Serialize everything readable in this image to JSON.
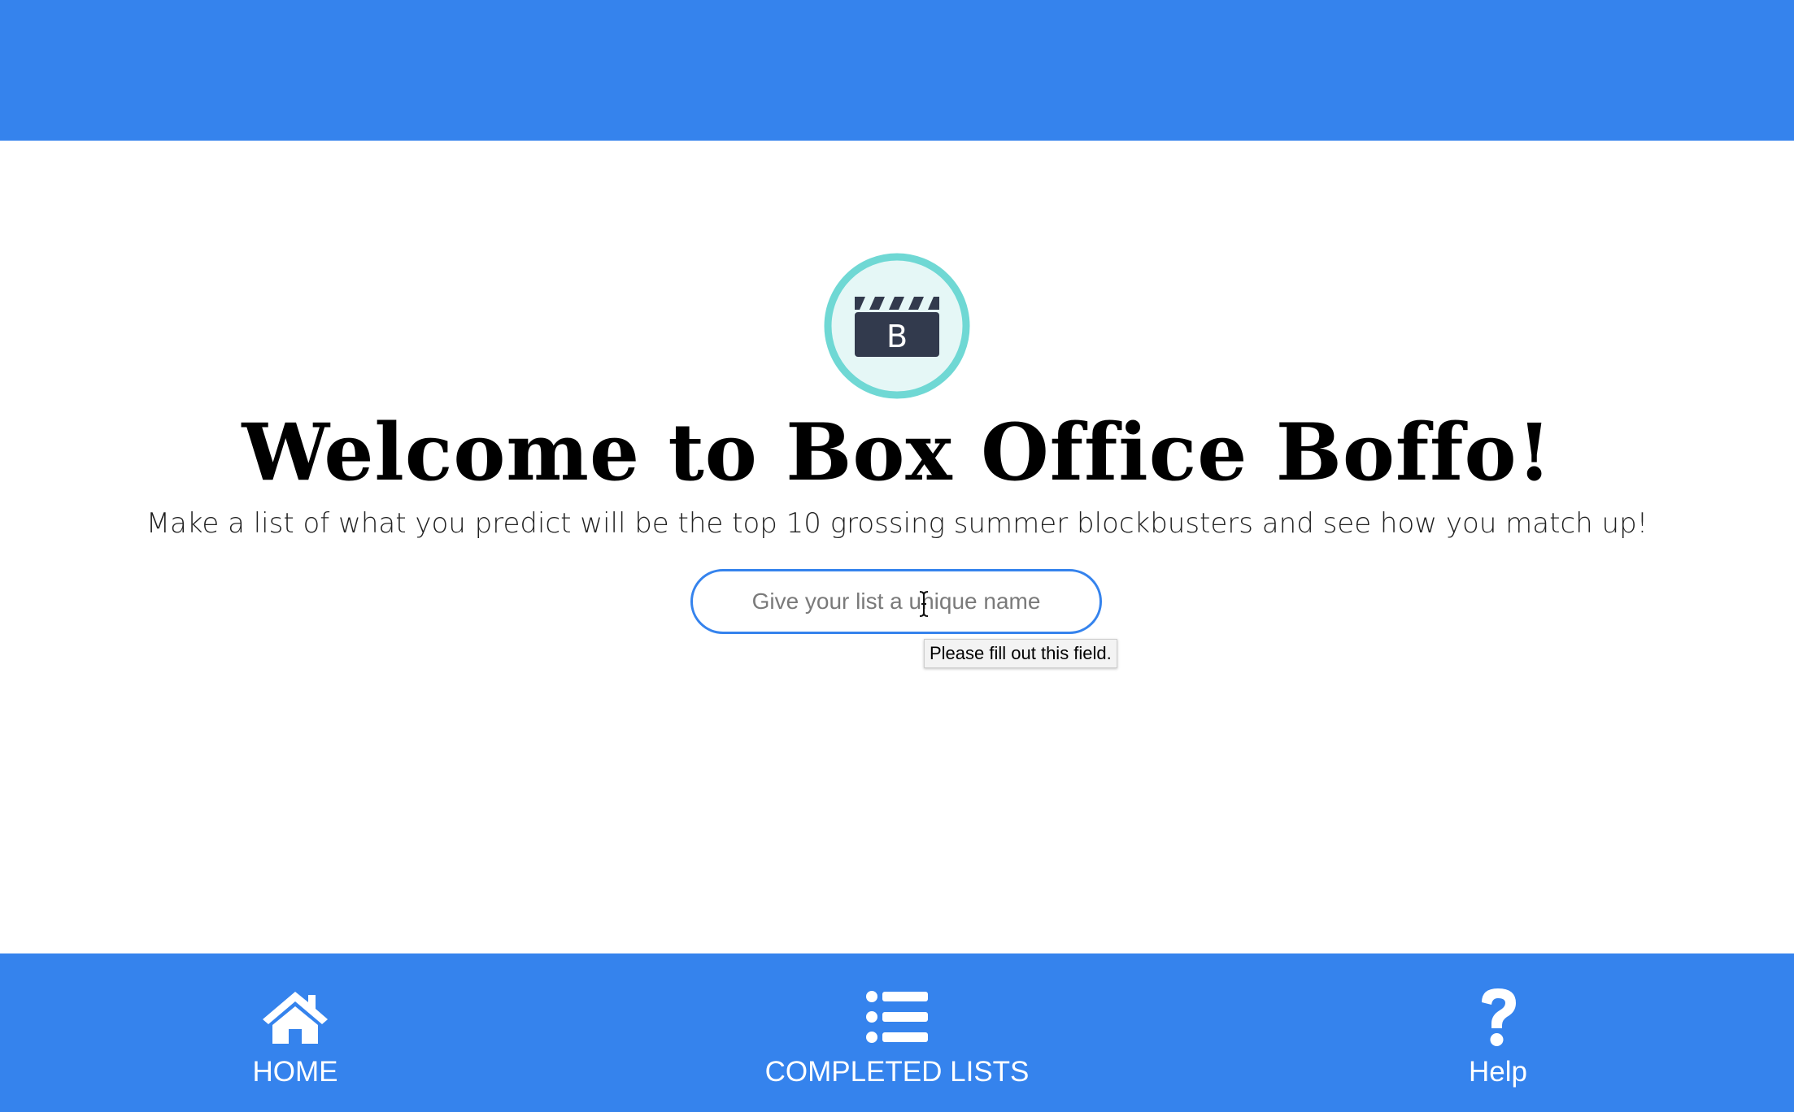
{
  "colors": {
    "brand_blue": "#3583ed",
    "logo_ring": "#6fd8d4",
    "logo_fill": "#e5f7f6",
    "logo_clapper": "#323a4d"
  },
  "logo": {
    "letter": "B",
    "icon": "clapperboard-icon"
  },
  "main": {
    "title": "Welcome to Box Office Boffo!",
    "subtitle": "Make a list of what you predict will be the top 10 grossing summer blockbusters and see how you match up!",
    "list_name_input": {
      "value": "",
      "placeholder": "Give your list a unique name"
    },
    "validation_tooltip": "Please fill out this field."
  },
  "bottom_nav": {
    "items": [
      {
        "label": "HOME",
        "icon": "home-icon"
      },
      {
        "label": "COMPLETED LISTS",
        "icon": "list-icon"
      },
      {
        "label": "Help",
        "icon": "question-icon"
      }
    ]
  }
}
